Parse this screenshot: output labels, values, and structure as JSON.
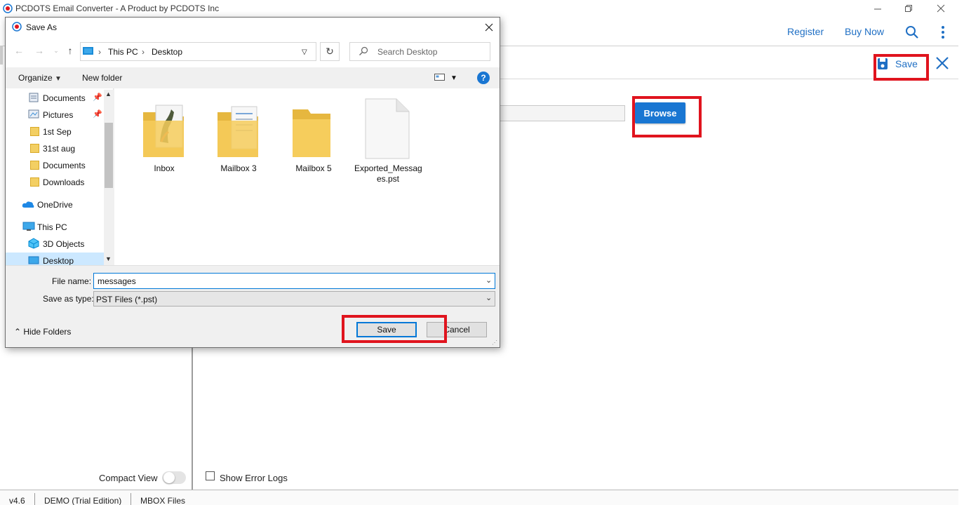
{
  "app": {
    "title": "PCDOTS Email Converter - A Product by PCDOTS Inc",
    "minimize_icon": "minimize-icon",
    "restore_icon": "restore-icon",
    "close_icon": "close-icon"
  },
  "toolbar": {
    "register": "Register",
    "buy_now": "Buy Now",
    "search_icon": "search-icon",
    "more_icon": "more-vertical-icon"
  },
  "actions": {
    "save": "Save",
    "browse": "Browse"
  },
  "footer": {
    "compact_view": "Compact View",
    "compact_view_on": false,
    "show_error_logs": "Show Error Logs",
    "show_error_logs_checked": false
  },
  "status": {
    "version": "v4.6",
    "edition": "DEMO (Trial Edition)",
    "file_type": "MBOX Files"
  },
  "dialog": {
    "title": "Save As",
    "breadcrumb": [
      "This PC",
      "Desktop"
    ],
    "search_placeholder": "Search Desktop",
    "organize": "Organize",
    "new_folder": "New folder",
    "nav_items": [
      {
        "label": "Documents",
        "icon": "documents-icon",
        "pinned": true
      },
      {
        "label": "Pictures",
        "icon": "pictures-icon",
        "pinned": true
      },
      {
        "label": "1st Sep",
        "icon": "folder-icon",
        "pinned": false
      },
      {
        "label": "31st aug",
        "icon": "folder-icon",
        "pinned": false
      },
      {
        "label": "Documents",
        "icon": "folder-icon",
        "pinned": false
      },
      {
        "label": "Downloads",
        "icon": "folder-icon",
        "pinned": false
      },
      {
        "label": "OneDrive",
        "icon": "onedrive-icon",
        "pinned": false
      },
      {
        "label": "This PC",
        "icon": "this-pc-icon",
        "pinned": false
      },
      {
        "label": "3D Objects",
        "icon": "3d-objects-icon",
        "pinned": false
      },
      {
        "label": "Desktop",
        "icon": "desktop-icon",
        "pinned": false,
        "selected": true
      }
    ],
    "files": [
      {
        "name": "Inbox",
        "kind": "folder"
      },
      {
        "name": "Mailbox 3",
        "kind": "folder"
      },
      {
        "name": "Mailbox 5",
        "kind": "folder"
      },
      {
        "name": "Exported_Messag",
        "name_line2": "es.pst",
        "kind": "file"
      }
    ],
    "file_name_label": "File name:",
    "file_name_value": "messages",
    "save_type_label": "Save as type:",
    "save_type_value": "PST Files (*.pst)",
    "hide_folders": "Hide Folders",
    "save_button": "Save",
    "cancel_button": "Cancel"
  },
  "colors": {
    "accent": "#1976d2",
    "highlight": "#e0141e",
    "folder": "#f3cf63"
  }
}
